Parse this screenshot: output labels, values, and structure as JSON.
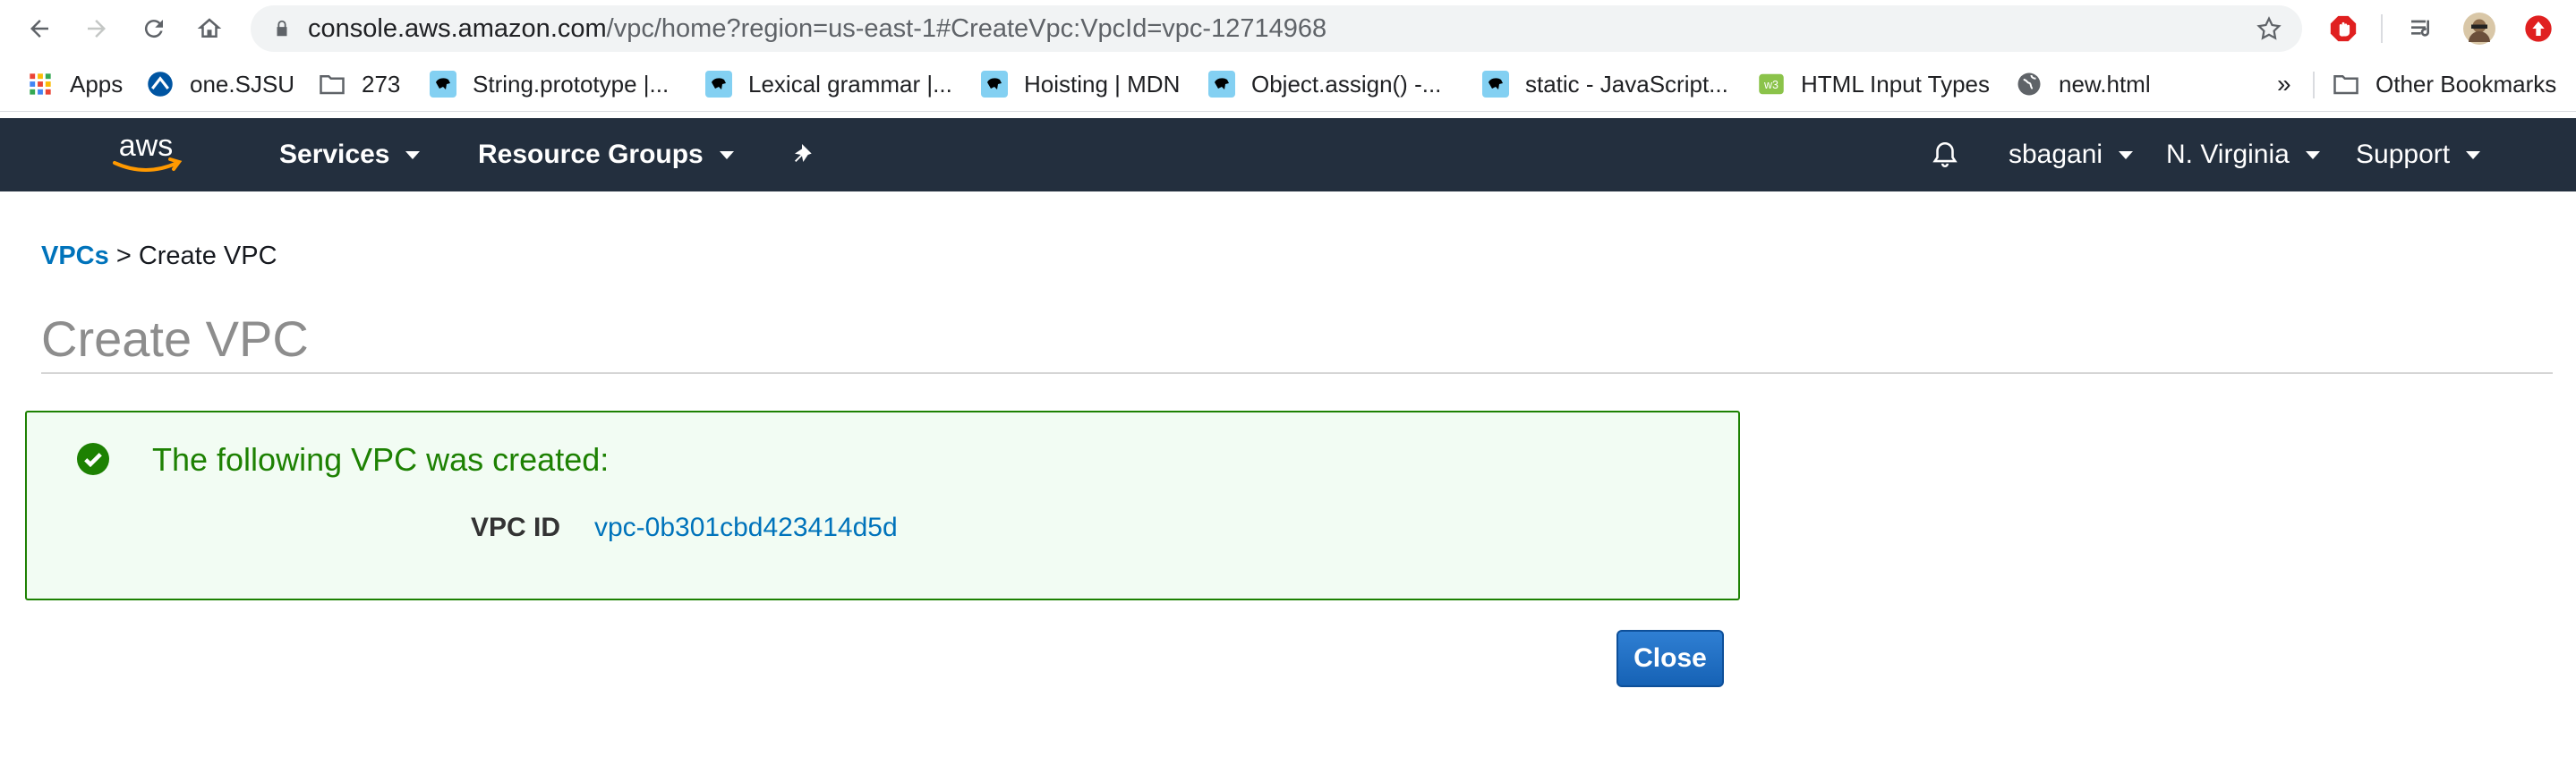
{
  "browser": {
    "url_domain": "console.aws.amazon.com",
    "url_path": "/vpc/home?region=us-east-1#CreateVpc:VpcId=vpc-12714968",
    "bookmarks": [
      {
        "label": "Apps",
        "icon": "apps-grid-icon"
      },
      {
        "label": "one.SJSU",
        "icon": "sjsu-icon"
      },
      {
        "label": "273",
        "icon": "folder-icon"
      },
      {
        "label": "String.prototype |...",
        "icon": "mdn-icon"
      },
      {
        "label": "Lexical grammar |...",
        "icon": "mdn-icon"
      },
      {
        "label": "Hoisting | MDN",
        "icon": "mdn-icon"
      },
      {
        "label": "Object.assign() -...",
        "icon": "mdn-icon"
      },
      {
        "label": "static - JavaScript...",
        "icon": "mdn-icon"
      },
      {
        "label": "HTML Input Types",
        "icon": "w3-icon"
      },
      {
        "label": "new.html",
        "icon": "globe-icon"
      }
    ],
    "overflow_label": "»",
    "other_bookmarks": "Other Bookmarks"
  },
  "awsnav": {
    "logo_text": "aws",
    "services": "Services",
    "resource_groups": "Resource Groups",
    "user": "sbagani",
    "region": "N. Virginia",
    "support": "Support"
  },
  "breadcrumb": {
    "link": "VPCs",
    "separator": ">",
    "current": "Create VPC"
  },
  "page": {
    "title": "Create VPC"
  },
  "result": {
    "message": "The following VPC was created:",
    "vpc_id_label": "VPC ID",
    "vpc_id_value": "vpc-0b301cbd423414d5d"
  },
  "actions": {
    "close": "Close"
  },
  "colors": {
    "aws_nav_bg": "#232f3e",
    "success_green": "#1d8102",
    "link_blue": "#0073bb",
    "button_blue": "#1662b5"
  }
}
